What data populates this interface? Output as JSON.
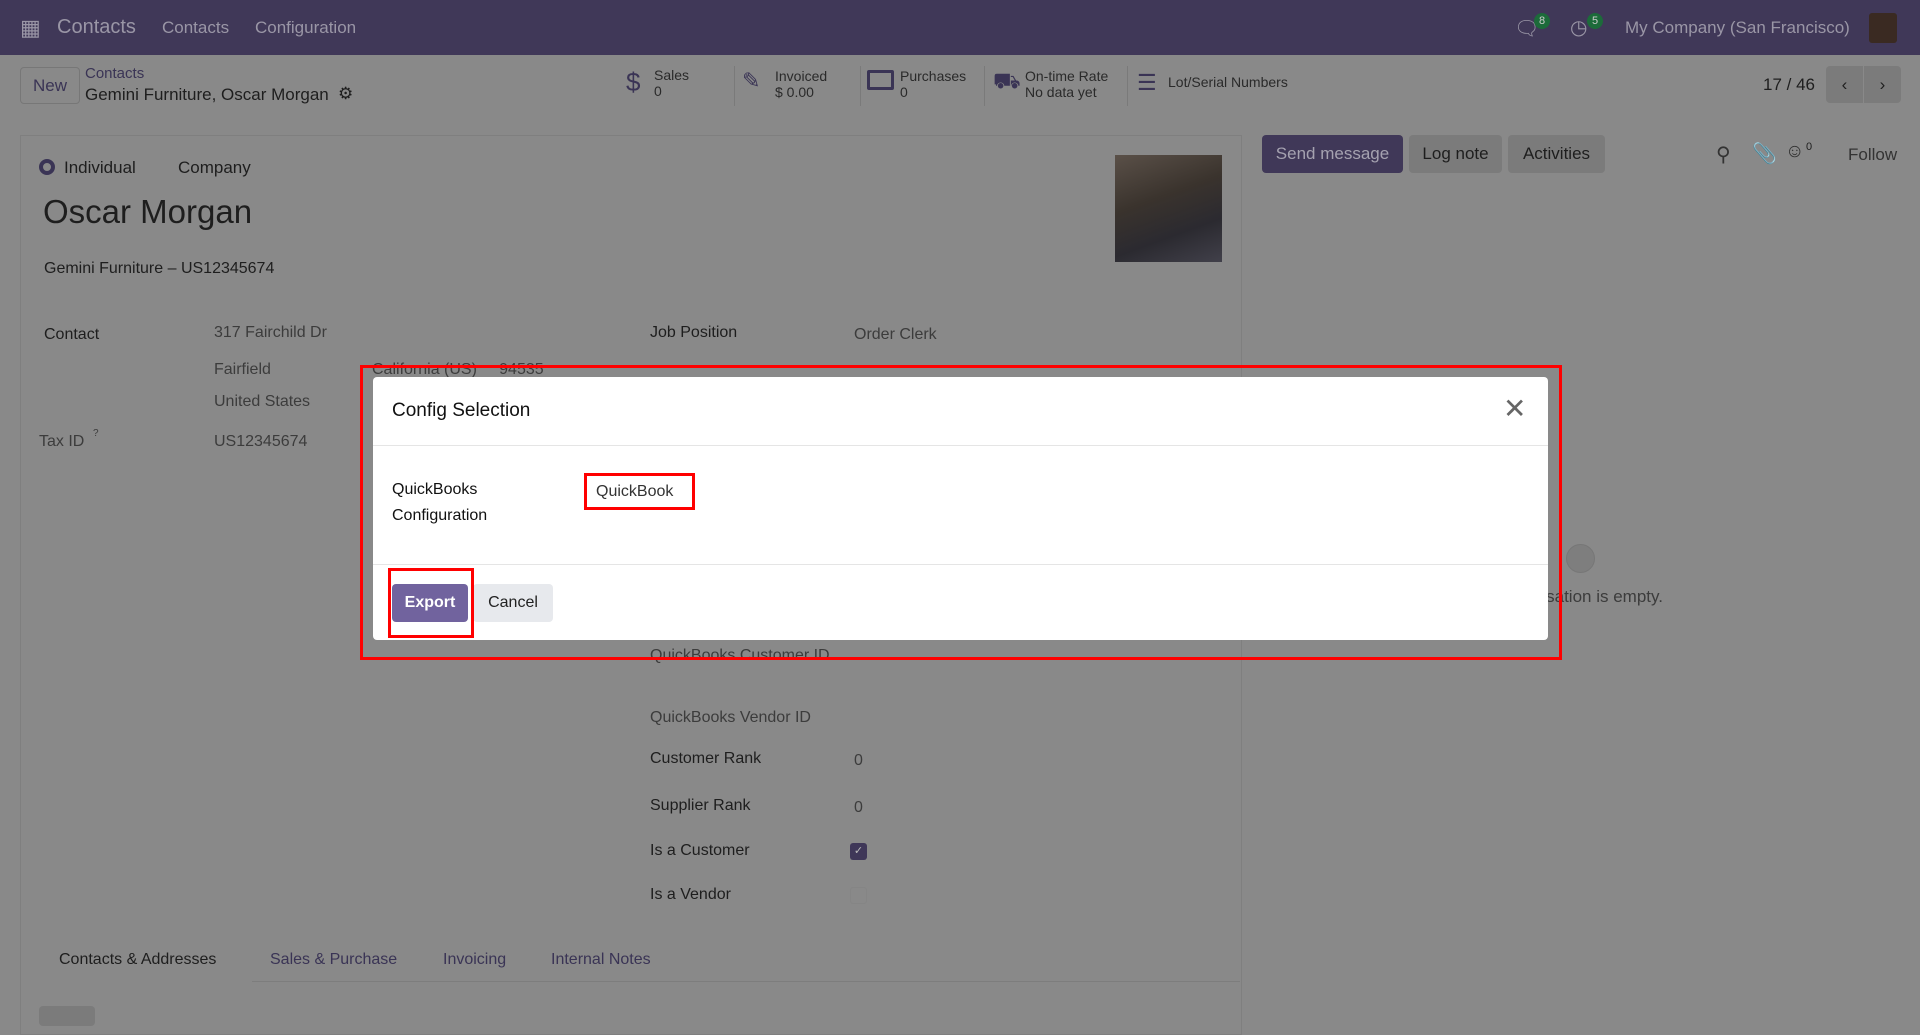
{
  "navbar": {
    "app": "Contacts",
    "menu": [
      "Contacts",
      "Configuration"
    ],
    "messages_count": "8",
    "activities_count": "5",
    "company": "My Company (San Francisco)"
  },
  "control": {
    "new_label": "New",
    "breadcrumb_parent": "Contacts",
    "breadcrumb_current": "Gemini Furniture, Oscar Morgan",
    "pager": "17 / 46",
    "stats": [
      {
        "label": "Sales",
        "value": "0"
      },
      {
        "label": "Invoiced",
        "value": "$ 0.00"
      },
      {
        "label": "Purchases",
        "value": "0"
      },
      {
        "label": "On-time Rate",
        "value": "No data yet"
      },
      {
        "label": "Lot/Serial Numbers",
        "value": ""
      }
    ]
  },
  "form": {
    "type_options": [
      "Individual",
      "Company"
    ],
    "name": "Oscar Morgan",
    "company_line": "Gemini Furniture – US12345674",
    "contact_label": "Contact",
    "street": "317 Fairchild Dr",
    "city": "Fairfield",
    "state_zip": "California (US)     94535",
    "country": "United States",
    "taxid_label": "Tax ID",
    "taxid_help": "?",
    "taxid": "US12345674",
    "job_label": "Job Position",
    "job": "Order Clerk",
    "qb_customer_label": "QuickBooks Customer ID",
    "qb_vendor_label": "QuickBooks Vendor ID",
    "customer_rank_label": "Customer Rank",
    "customer_rank": "0",
    "supplier_rank_label": "Supplier Rank",
    "supplier_rank": "0",
    "is_customer_label": "Is a Customer",
    "is_customer": true,
    "is_vendor_label": "Is a Vendor",
    "is_vendor": false,
    "tabs": [
      "Contacts & Addresses",
      "Sales & Purchase",
      "Invoicing",
      "Internal Notes"
    ]
  },
  "chatter": {
    "send": "Send message",
    "log": "Log note",
    "activities": "Activities",
    "followers": "0",
    "follow": "Follow",
    "empty": "ersation is empty."
  },
  "modal": {
    "title": "Config Selection",
    "field_label_1": "QuickBooks",
    "field_label_2": "Configuration",
    "field_value": "QuickBook",
    "export": "Export",
    "cancel": "Cancel"
  },
  "colors": {
    "primary": "#71639e",
    "highlight": "#ff0000"
  }
}
